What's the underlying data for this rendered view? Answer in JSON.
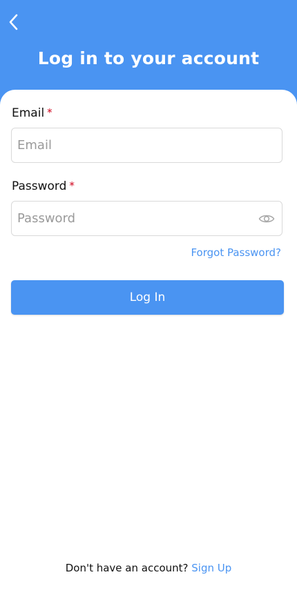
{
  "header": {
    "title": "Log in to your account",
    "back_icon": "chevron-left-icon",
    "background_color": "#4a94f2"
  },
  "form": {
    "email_label": "Email",
    "email_required_mark": "*",
    "email_placeholder": "Email",
    "email_value": "",
    "password_label": "Password",
    "password_required_mark": "*",
    "password_placeholder": "Password",
    "password_value": "",
    "password_toggle_icon": "eye-icon",
    "forgot_password_label": "Forgot Password?",
    "login_button_label": "Log In"
  },
  "footer": {
    "prompt_text": "Don't have an account?",
    "signup_link_label": "Sign Up"
  },
  "colors": {
    "accent": "#4a94f2",
    "required": "#d0021b"
  }
}
